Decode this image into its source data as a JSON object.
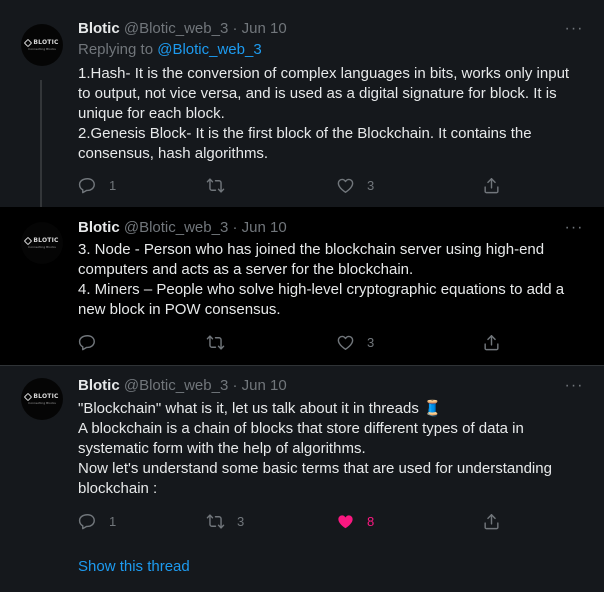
{
  "colors": {
    "background": "#000000",
    "focused_background": "#15181c",
    "text": "#e7e9ea",
    "muted": "#71767b",
    "link": "#1d9bf0",
    "like_active": "#f91880"
  },
  "tweets": [
    {
      "author": {
        "name": "Blotic",
        "handle": "@Blotic_web_3",
        "separator": "·",
        "date": "Jun 10",
        "avatar_logo": "BLOTIC",
        "avatar_tagline": "Connecting Blocks"
      },
      "more_icon": "more-horizontal-icon",
      "replying": {
        "prefix": "Replying to ",
        "mention": "@Blotic_web_3"
      },
      "lines": [
        "1.Hash- It is the conversion of complex languages in bits, works only input to output, not vice versa, and is used as a digital signature for block. It is unique for each block.",
        "2.Genesis Block- It is the first block of the Blockchain. It contains the consensus, hash algorithms."
      ],
      "actions": {
        "replies": "1",
        "retweets": "",
        "likes": "3",
        "liked": false
      }
    },
    {
      "author": {
        "name": "Blotic",
        "handle": "@Blotic_web_3",
        "separator": "·",
        "date": "Jun 10",
        "avatar_logo": "BLOTIC",
        "avatar_tagline": "Connecting Blocks"
      },
      "more_icon": "more-horizontal-icon",
      "lines": [
        "3.  Node - Person who has joined the blockchain server using high-end computers and acts as a server for the blockchain.",
        "4.  Miners – People who solve high-level cryptographic equations to add a new block in POW consensus."
      ],
      "actions": {
        "replies": "",
        "retweets": "",
        "likes": "3",
        "liked": false
      }
    },
    {
      "author": {
        "name": "Blotic",
        "handle": "@Blotic_web_3",
        "separator": "·",
        "date": "Jun 10",
        "avatar_logo": "BLOTIC",
        "avatar_tagline": "Connecting Blocks"
      },
      "more_icon": "more-horizontal-icon",
      "lines": [
        "\"Blockchain\" what is it, let us talk about it in threads 🧵",
        "A blockchain is a chain of blocks that store different types of data in systematic form with the help of algorithms.",
        "Now let's understand some basic terms that are used for understanding blockchain :"
      ],
      "actions": {
        "replies": "1",
        "retweets": "3",
        "likes": "8",
        "liked": true
      }
    }
  ],
  "show_thread_label": "Show this thread"
}
